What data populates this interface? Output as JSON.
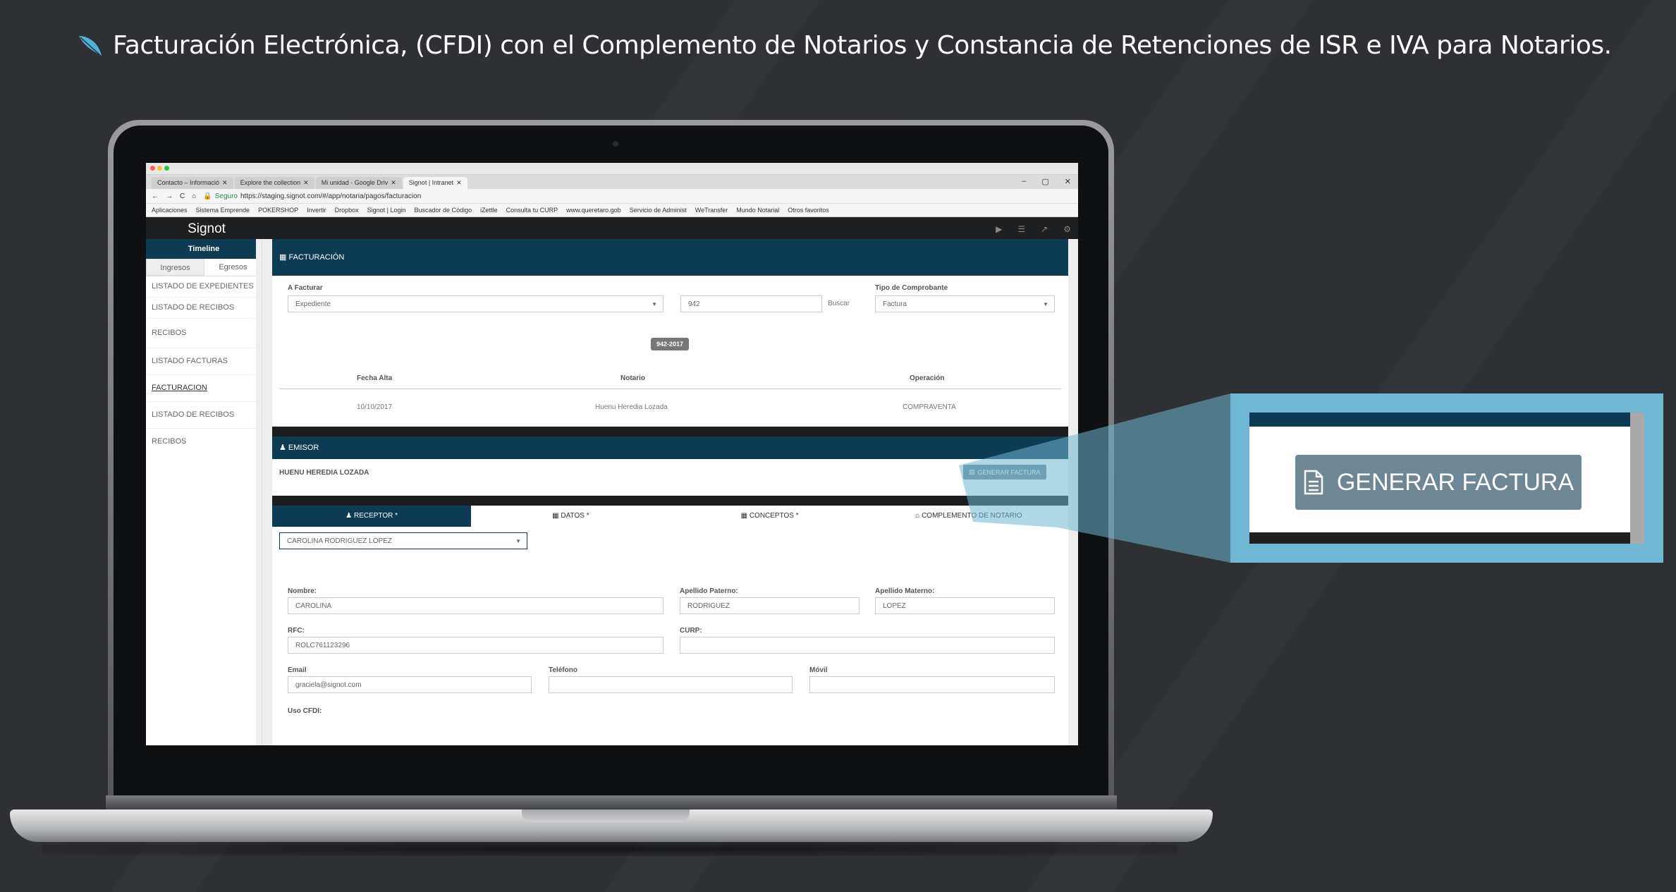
{
  "headline": "Facturación Electrónica, (CFDI) con el Complemento de Notarios y Constancia de Retenciones de ISR e IVA para Notarios.",
  "browser": {
    "tabs": [
      "Contacto – Informació",
      "Explore the collection",
      "Mi unidad - Google Driv",
      "Signot | Intranet"
    ],
    "secure_label": "Seguro",
    "url": "https://staging.signot.com/#/app/notaria/pagos/facturacion",
    "bookmarks": [
      "Aplicaciones",
      "Sistema Emprende",
      "POKERSHOP",
      "Invertir",
      "Dropbox",
      "Signot | Login",
      "Buscador de Código",
      "iZettle",
      "Consulta tu CURP",
      "www.queretaro.gob",
      "Servicio de Administ",
      "WeTransfer",
      "Mundo Notarial",
      "Otros favoritos"
    ]
  },
  "app": {
    "logo": "Signot",
    "sidebar": {
      "title": "Timeline",
      "tabs": [
        "Ingresos",
        "Egresos"
      ],
      "items": [
        "LISTADO DE EXPEDIENTES",
        "LISTADO DE RECIBOS",
        "RECIBOS",
        "LISTADO FACTURAS",
        "FACTURACION",
        "LISTADO DE RECIBOS",
        "RECIBOS"
      ]
    },
    "facturacion": {
      "title": "FACTURACIÓN",
      "a_facturar_label": "A Facturar",
      "a_facturar_value": "Expediente",
      "expediente_num": "942",
      "buscar": "Buscar",
      "tipo_label": "Tipo de Comprobante",
      "tipo_value": "Factura",
      "badge": "942-2017",
      "columns": [
        "Fecha Alta",
        "Notario",
        "Operación"
      ],
      "row": [
        "10/10/2017",
        "Huenu Heredia Lozada",
        "COMPRAVENTA"
      ]
    },
    "emisor": {
      "title": "EMISOR",
      "name": "HUENU HEREDIA LOZADA",
      "button": "GENERAR FACTURA"
    },
    "tabs": [
      "RECEPTOR *",
      "DATOS *",
      "CONCEPTOS *",
      "COMPLEMENTO DE NOTARIO"
    ],
    "receptor": {
      "select_value": "CAROLINA RODRIGUEZ LOPEZ",
      "nombre_label": "Nombre:",
      "nombre": "CAROLINA",
      "paterno_label": "Apellido Paterno:",
      "paterno": "RODRIGUEZ",
      "materno_label": "Apellido Materno:",
      "materno": "LOPEZ",
      "rfc_label": "RFC:",
      "rfc": "ROLC761123296",
      "curp_label": "CURP:",
      "curp": "",
      "email_label": "Email",
      "email": "graciela@signot.com",
      "telefono_label": "Teléfono",
      "telefono": "",
      "movil_label": "Móvil",
      "movil": "",
      "uso_label": "Uso CFDI:"
    }
  },
  "callout": {
    "button": "GENERAR FACTURA"
  },
  "colors": {
    "background": "#2f3033",
    "app_primary": "#0c3b53",
    "button": "#6d8797",
    "callout": "#6fb7d2",
    "feather": "#4fb3d9"
  }
}
